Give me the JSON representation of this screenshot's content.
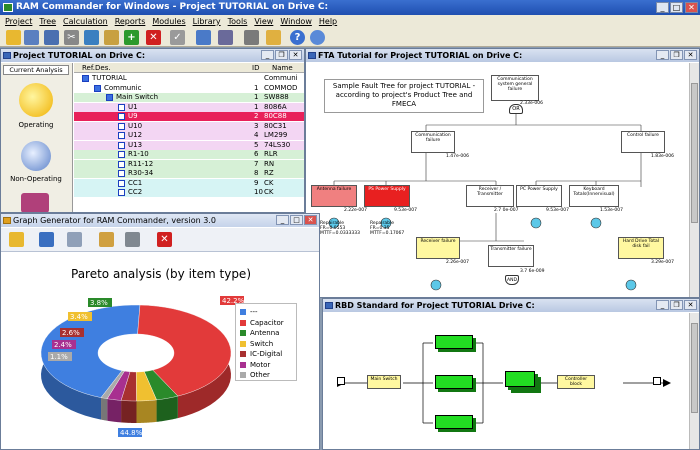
{
  "app": {
    "title": "RAM Commander for Windows - Project TUTORIAL on Drive C:",
    "menus": [
      "Project",
      "Tree",
      "Calculation",
      "Reports",
      "Modules",
      "Library",
      "Tools",
      "View",
      "Window",
      "Help"
    ]
  },
  "project_window": {
    "title": "Project TUTORIAL on Drive C:",
    "tab": "Current Analysis",
    "modes": [
      {
        "label": "Operating"
      },
      {
        "label": "Non-Operating"
      }
    ],
    "columns": [
      "Ref.Des.",
      "ID",
      "Name"
    ],
    "rows": [
      {
        "ref": "TUTORIAL",
        "id": "",
        "name": "Communi"
      },
      {
        "ref": "Communic",
        "id": "1",
        "name": "COMMOD"
      },
      {
        "ref": "Main Switch",
        "id": "1",
        "name": "SW888"
      },
      {
        "ref": "U1",
        "id": "1",
        "name": "8086A"
      },
      {
        "ref": "U9",
        "id": "2",
        "name": "80C88"
      },
      {
        "ref": "U10",
        "id": "3",
        "name": "80C31"
      },
      {
        "ref": "U12",
        "id": "4",
        "name": "LM299"
      },
      {
        "ref": "U13",
        "id": "5",
        "name": "74LS30"
      },
      {
        "ref": "R1-10",
        "id": "6",
        "name": "RLR"
      },
      {
        "ref": "R11-12",
        "id": "7",
        "name": "RN"
      },
      {
        "ref": "R30-34",
        "id": "8",
        "name": "RZ"
      },
      {
        "ref": "CC1",
        "id": "9",
        "name": "CK"
      },
      {
        "ref": "CC2",
        "id": "10",
        "name": "CK"
      }
    ]
  },
  "fta_window": {
    "title": "FTA Tutorial for Project TUTORIAL on Drive C:",
    "note": "Sample Fault Tree for project TUTORIAL - according to project's Product Tree and FMECA",
    "top_event": {
      "label": "Communication system general failure",
      "rate": "2.33e-006"
    },
    "events": [
      {
        "label": "Communication failure",
        "rate": "1.47e-006"
      },
      {
        "label": "Control failure",
        "rate": "1.83e-006"
      },
      {
        "label": "Antenna failure",
        "rate": "2.22e-007"
      },
      {
        "label": "PS Power Supply",
        "rate": "9.53e-007"
      },
      {
        "label": "Receiver / Transmitter",
        "rate": "2.7 0e-007"
      },
      {
        "label": "PC Power Supply",
        "rate": "9.53e-007"
      },
      {
        "label": "Keyboard Totals(Innervisual)",
        "rate": "1.53e-007"
      },
      {
        "label": "Receiver failure",
        "rate": "2.26e-007"
      },
      {
        "label": "Transmitter failure",
        "rate": "3.7 6e-009"
      },
      {
        "label": "Hard Drive Total disk fail",
        "rate": "3.29e-007"
      }
    ],
    "gate_or": "OR",
    "gate_and": "AND",
    "sub_text": [
      "Repairable",
      "FR=0.0553",
      "MTTF=0.0333333",
      "Repairable",
      "FR=0.35",
      "MTTF=0.17067"
    ]
  },
  "graph_window": {
    "title": "Graph Generator for RAM Commander, version 3.0",
    "chart_title": "Pareto analysis (by item type)",
    "legend": [
      {
        "name": "---",
        "color": "#3f7fe0"
      },
      {
        "name": "Capacitor",
        "color": "#e23a3a"
      },
      {
        "name": "Antenna",
        "color": "#2a8a2a"
      },
      {
        "name": "Switch",
        "color": "#f0c030"
      },
      {
        "name": "IC-Digital",
        "color": "#a83030"
      },
      {
        "name": "Motor",
        "color": "#a83090"
      },
      {
        "name": "Other",
        "color": "#aaaaaa"
      }
    ],
    "chart_data": {
      "type": "pie",
      "title": "Pareto analysis (by item type)",
      "categories": [
        "---",
        "Capacitor",
        "Antenna",
        "Switch",
        "IC-Digital",
        "Motor",
        "Other"
      ],
      "values": [
        44.8,
        42.2,
        3.8,
        3.4,
        2.6,
        2.4,
        1.1
      ],
      "labels": [
        "44.8%",
        "42.2%",
        "3.8%",
        "3.4%",
        "2.6%",
        "2.4%",
        "1.1%"
      ]
    }
  },
  "rbd_window": {
    "title": "RBD Standard for Project TUTORIAL Drive C:",
    "blocks": [
      "Main Switch",
      "Controller block"
    ]
  }
}
